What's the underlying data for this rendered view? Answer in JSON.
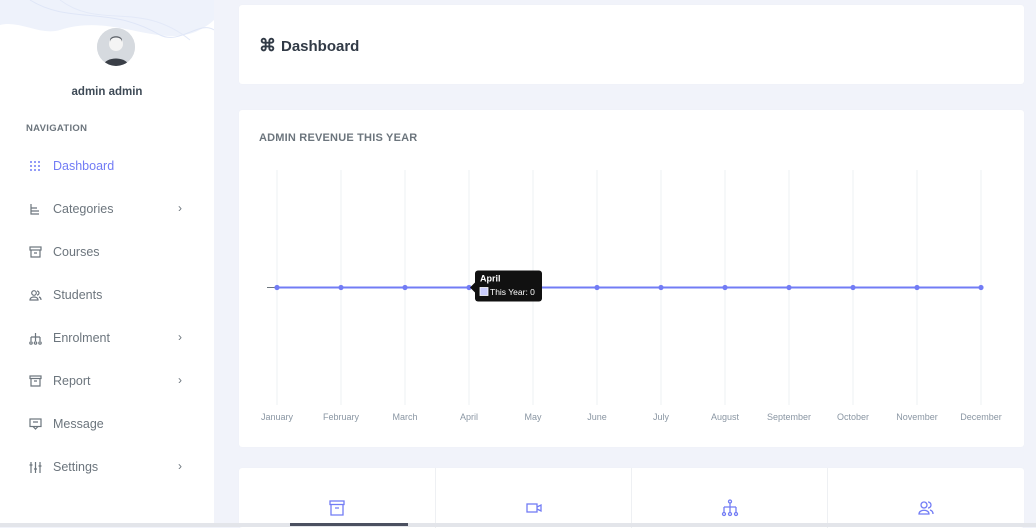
{
  "user": {
    "name": "admin admin"
  },
  "navigation": {
    "title": "NAVIGATION",
    "items": [
      {
        "label": "Dashboard",
        "icon": "grid-dots-icon",
        "active": true,
        "has_submenu": false
      },
      {
        "label": "Categories",
        "icon": "hierarchy-icon",
        "active": false,
        "has_submenu": true
      },
      {
        "label": "Courses",
        "icon": "archive-icon",
        "active": false,
        "has_submenu": false
      },
      {
        "label": "Students",
        "icon": "users-icon",
        "active": false,
        "has_submenu": false
      },
      {
        "label": "Enrolment",
        "icon": "sitemap-icon",
        "active": false,
        "has_submenu": true
      },
      {
        "label": "Report",
        "icon": "box-icon",
        "active": false,
        "has_submenu": true
      },
      {
        "label": "Message",
        "icon": "message-icon",
        "active": false,
        "has_submenu": false
      },
      {
        "label": "Settings",
        "icon": "sliders-icon",
        "active": false,
        "has_submenu": true
      }
    ],
    "chevron": "›"
  },
  "header": {
    "title": "Dashboard",
    "title_icon": "⌘"
  },
  "chart_card": {
    "title": "ADMIN REVENUE THIS YEAR"
  },
  "chart_data": {
    "type": "line",
    "categories": [
      "January",
      "February",
      "March",
      "April",
      "May",
      "June",
      "July",
      "August",
      "September",
      "October",
      "November",
      "December"
    ],
    "series": [
      {
        "name": "This Year",
        "values": [
          0,
          0,
          0,
          0,
          0,
          0,
          0,
          0,
          0,
          0,
          0,
          0
        ]
      }
    ],
    "grid": "vertical",
    "colors": {
      "line": "#727cf5",
      "grid": "#eef0f3"
    },
    "tooltip": {
      "title": "April",
      "label": "This Year: 0"
    }
  },
  "stat_tiles": [
    {
      "icon": "archive-icon"
    },
    {
      "icon": "video-icon"
    },
    {
      "icon": "sitemap-icon"
    },
    {
      "icon": "users-icon"
    }
  ],
  "colors": {
    "accent": "#727cf5",
    "background": "#f1f3fa",
    "card": "#ffffff",
    "text": "#6c757d"
  }
}
